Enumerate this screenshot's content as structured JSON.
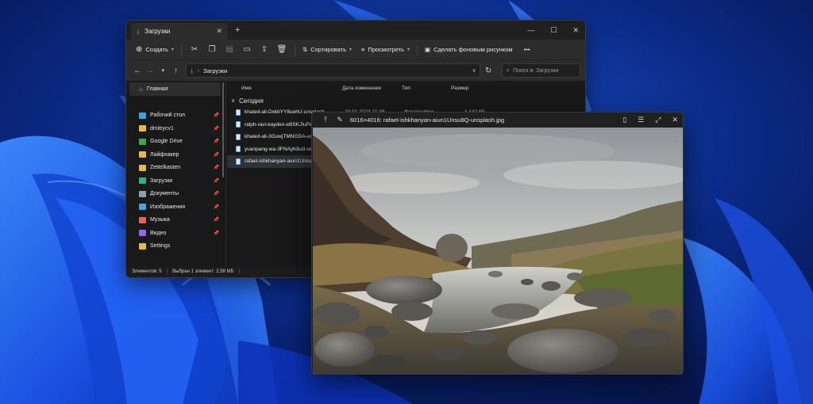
{
  "explorer": {
    "tab_title": "Загрузки",
    "toolbar": {
      "create_label": "Создать",
      "sort_label": "Сортировать",
      "view_label": "Просмотреть",
      "wallpaper_label": "Сделать фоновым рисунком",
      "more_label": "•••"
    },
    "address": {
      "path": "Загрузки",
      "search_placeholder": "Поиск в: Загрузки"
    },
    "sidebar": {
      "home": "Главная",
      "items": [
        {
          "label": "Рабочий стол",
          "color": "#3aa3e3"
        },
        {
          "label": "dmitrycv1",
          "color": "#e8b84a"
        },
        {
          "label": "Google Drive",
          "color": "#34a853"
        },
        {
          "label": "Лайфхакер",
          "color": "#e8b84a"
        },
        {
          "label": "Zettelkasten",
          "color": "#e8b84a"
        },
        {
          "label": "Загрузки",
          "color": "#2fb37a"
        },
        {
          "label": "Документы",
          "color": "#8aa0b8"
        },
        {
          "label": "Изображения",
          "color": "#4aa3e8"
        },
        {
          "label": "Музыка",
          "color": "#e8645a"
        },
        {
          "label": "Видео",
          "color": "#8e6ae8"
        },
        {
          "label": "Settings",
          "color": "#e8b84a"
        }
      ]
    },
    "columns": {
      "name": "Имя",
      "date": "Дата изменения",
      "type": "Тип",
      "size": "Размер"
    },
    "group_label": "Сегодня",
    "files": [
      {
        "name": "khaled-ali-DxkbYY8uehU-unsplash",
        "date": "20.01.2023 21:38",
        "type": "Фотографии",
        "size": "4 442 КБ"
      },
      {
        "name": "ralph-ravi-kayden-eBSKJIuPeOI",
        "date": "",
        "type": "",
        "size": ""
      },
      {
        "name": "khaled-ali-3GuwjTMNGDA-unsp",
        "date": "",
        "type": "",
        "size": ""
      },
      {
        "name": "yuanpang-wa-3FNAyb3uzl-unsp",
        "date": "",
        "type": "",
        "size": ""
      },
      {
        "name": "rafael-ishkhanyan-aiun1Unsu8Q",
        "date": "",
        "type": "",
        "size": ""
      }
    ],
    "status": {
      "count": "Элементов: 5",
      "selected": "Выбран 1 элемент: 2,58 МБ"
    }
  },
  "viewer": {
    "title": "6016×4016: rafael-ishkhanyan-aiun1Unsu8Q-unsplash.jpg"
  }
}
